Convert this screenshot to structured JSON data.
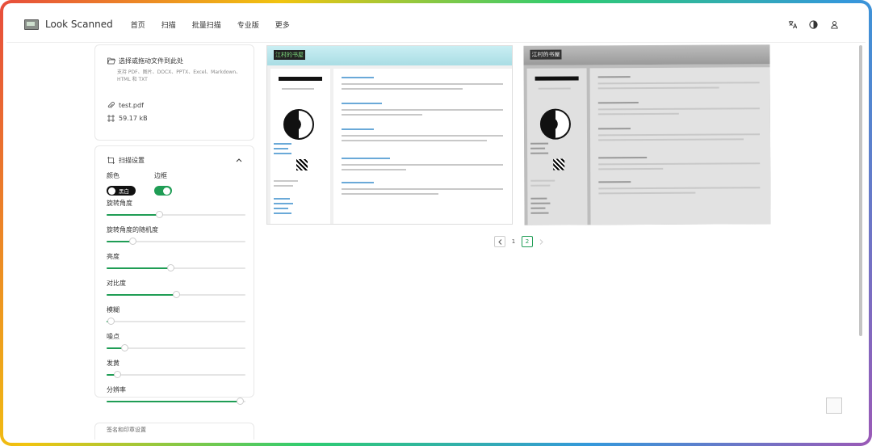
{
  "app": {
    "name": "Look Scanned"
  },
  "nav": {
    "items": [
      "首页",
      "扫描",
      "批量扫描",
      "专业版",
      "更多"
    ],
    "right_icons": [
      "translate-icon",
      "theme-contrast-icon",
      "user-icon"
    ]
  },
  "upload": {
    "title": "选择或拖动文件到此处",
    "subtitle": "支持 PDF、图片、DOCX、PPTX、Excel、Markdown、HTML 和 TXT"
  },
  "file": {
    "name": "test.pdf",
    "size": "59.17 kB"
  },
  "settings": {
    "title": "扫描设置",
    "color_label": "颜色",
    "color_value": "黑白",
    "border_label": "边框",
    "border_on": true,
    "sliders": [
      {
        "label": "旋转角度",
        "value": 0.38
      },
      {
        "label": "旋转角度的随机度",
        "value": 0.19
      },
      {
        "label": "亮度",
        "value": 0.46
      },
      {
        "label": "对比度",
        "value": 0.5
      },
      {
        "label": "模糊",
        "value": 0.03
      },
      {
        "label": "噪点",
        "value": 0.13
      },
      {
        "label": "发黄",
        "value": 0.08
      },
      {
        "label": "分辨率",
        "value": 0.96
      }
    ]
  },
  "next_section": {
    "title": "签名和印章设置"
  },
  "preview": {
    "page_title": "江村的书屋"
  },
  "pagination": {
    "pages": [
      "1",
      "2"
    ],
    "current": "2"
  },
  "colors": {
    "accent": "#1f9d55",
    "switch_off": "#111111"
  }
}
